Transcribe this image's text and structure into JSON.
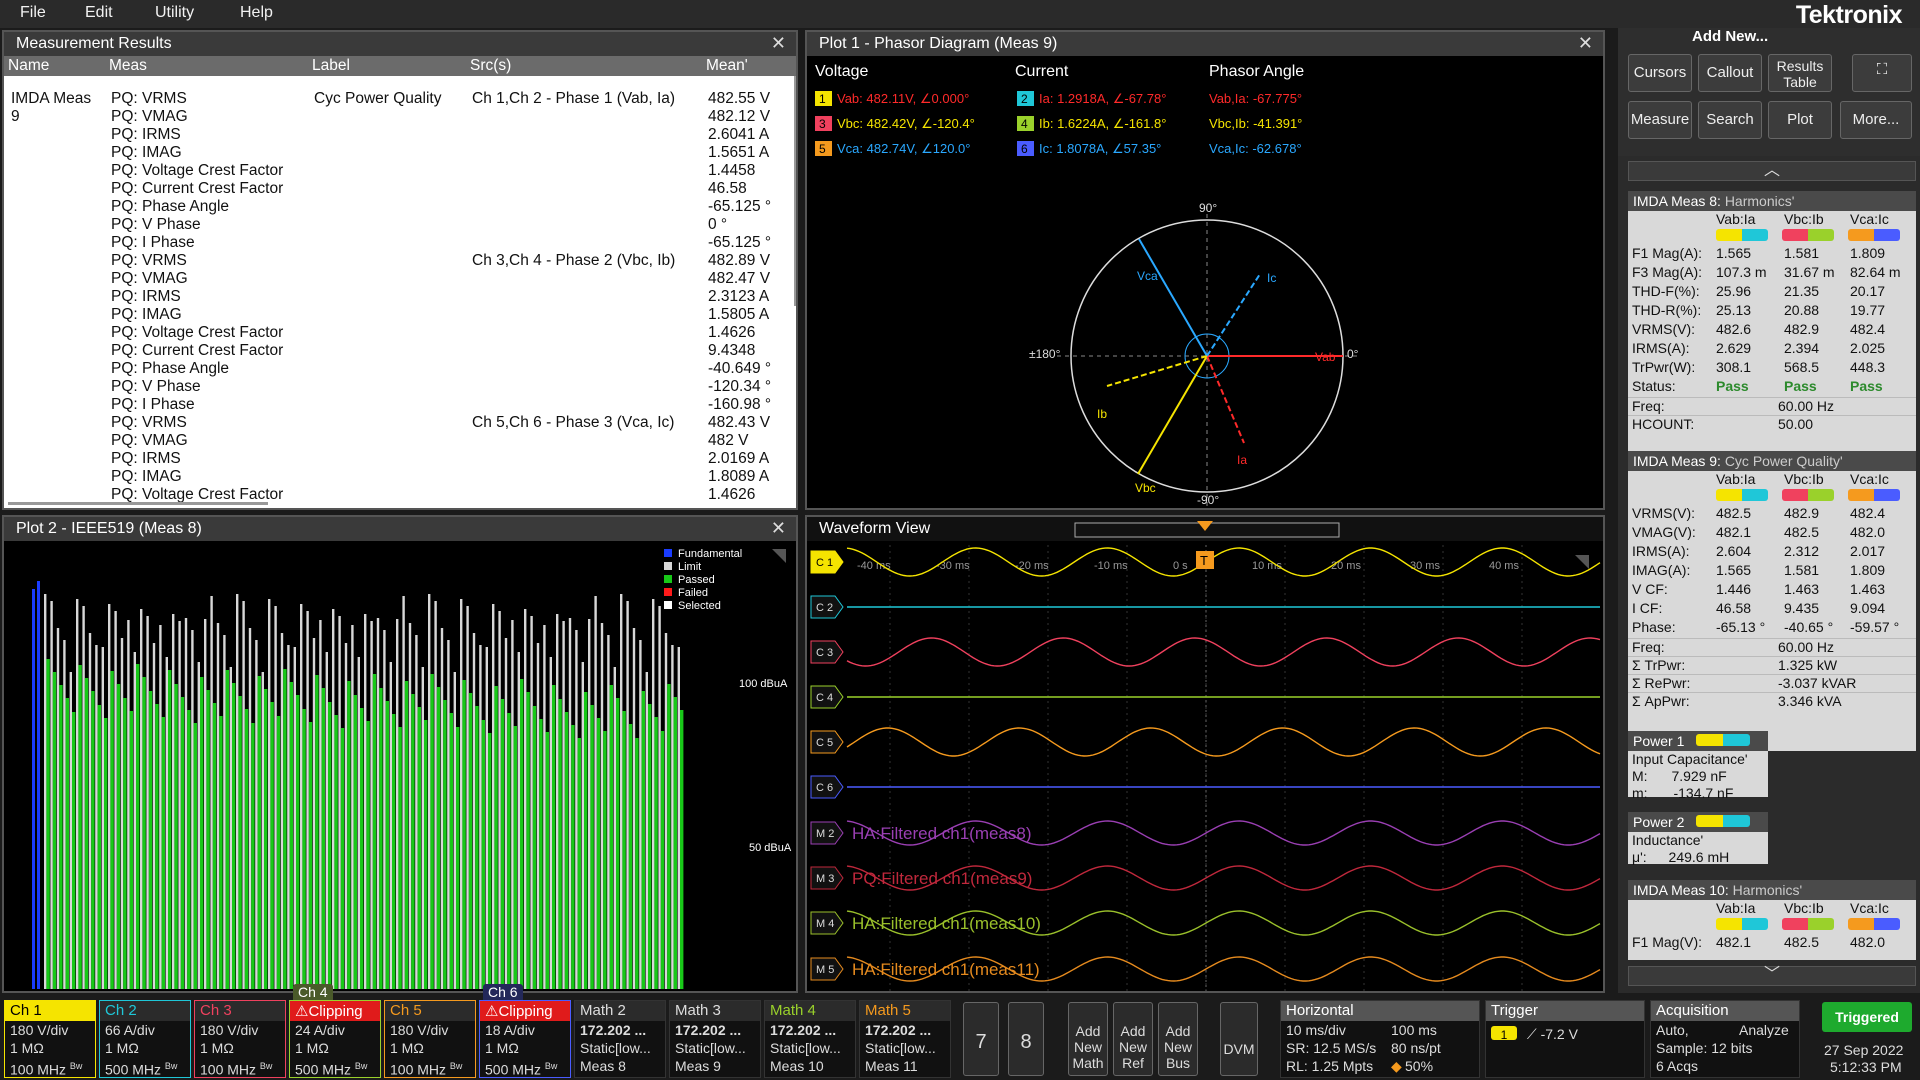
{
  "menu": [
    "File",
    "Edit",
    "Utility",
    "Help"
  ],
  "brand": "Tektronix",
  "meas": {
    "title": "Measurement Results",
    "headers": [
      "Name",
      "Meas",
      "Label",
      "Src(s)",
      "Mean'"
    ],
    "name": "IMDA Meas\n9",
    "meas": "PQ: VRMS\nPQ: VMAG\nPQ: IRMS\nPQ: IMAG\nPQ: Voltage Crest Factor\nPQ: Current Crest Factor\nPQ: Phase Angle\nPQ: V Phase\nPQ: I Phase\nPQ: VRMS\nPQ: VMAG\nPQ: IRMS\nPQ: IMAG\nPQ: Voltage Crest Factor\nPQ: Current Crest Factor\nPQ: Phase Angle\nPQ: V Phase\nPQ: I Phase\nPQ: VRMS\nPQ: VMAG\nPQ: IRMS\nPQ: IMAG\nPQ: Voltage Crest Factor",
    "label": "Cyc Power Quality",
    "src1": "Ch 1,Ch 2 - Phase 1 (Vab, Ia)",
    "src2": "Ch 3,Ch 4 - Phase 2 (Vbc, Ib)",
    "src3": "Ch 5,Ch 6 - Phase 3 (Vca, Ic)",
    "mean": "482.55 V\n482.12 V\n2.6041 A\n1.5651 A\n1.4458\n46.58\n-65.125 °\n0 °\n-65.125 °\n482.89 V\n482.47 V\n2.3123 A\n1.5805 A\n1.4626\n9.4348\n-40.649 °\n-120.34 °\n-160.98 °\n482.43 V\n482 V\n2.0169 A\n1.8089 A\n1.4626"
  },
  "phasor": {
    "title": "Plot 1 - Phasor Diagram (Meas 9)",
    "h_volt": "Voltage",
    "h_cur": "Current",
    "h_ang": "Phasor Angle",
    "v1": "Vab: 482.11V, ∠0.000°",
    "v2": "Vbc: 482.42V, ∠-120.4°",
    "v3": "Vca: 482.74V, ∠120.0°",
    "i1": "Ia: 1.2918A, ∠-67.78°",
    "i2": "Ib: 1.6224A, ∠-161.8°",
    "i3": "Ic: 1.8078A, ∠57.35°",
    "a1": "Vab,Ia: -67.775°",
    "a2": "Vbc,Ib: -41.391°",
    "a3": "Vca,Ic: -62.678°",
    "n1": "1",
    "n2": "3",
    "n3": "5",
    "n4": "2",
    "n5": "4",
    "n6": "6",
    "deg90": "90°",
    "degm90": "-90°",
    "deg0": "0°",
    "deg180": "±180°",
    "vab": "Vab",
    "vbc": "Vbc",
    "vca": "Vca",
    "ia": "Ia",
    "ib": "Ib",
    "ic": "Ic"
  },
  "ieee": {
    "title": "Plot 2 - IEEE519 (Meas 8)",
    "legend": [
      "Fundamental",
      "Limit",
      "Passed",
      "Failed",
      "Selected"
    ],
    "lbl100": "100 dBuA",
    "lbl50": "50 dBuA",
    "colors": {
      "fundamental": "#1a3cff",
      "limit": "#d8d8d8",
      "passed": "#18c818",
      "failed": "#ff1a1a",
      "selected": "#ffffff"
    }
  },
  "wave": {
    "title": "Waveform View",
    "times": [
      "-40 ms",
      "-30 ms",
      "-20 ms",
      "-10 ms",
      "0 s",
      "10 ms",
      "20 ms",
      "30 ms",
      "40 ms"
    ],
    "ch": [
      "C 1",
      "C 2",
      "C 3",
      "C 4",
      "C 5",
      "C 6",
      "M 2",
      "M 3",
      "M 4",
      "M 5"
    ],
    "math": [
      "HA:Filtered ch1(meas8)",
      "PQ:Filtered ch1(meas9)",
      "HA:Filtered ch1(meas10)",
      "HA:Filtered ch1(meas11)"
    ],
    "trig": "T"
  },
  "right": {
    "addnew": "Add New...",
    "btns": [
      "Cursors",
      "Callout",
      "Results Table",
      "Measure",
      "Search",
      "Plot",
      "More..."
    ],
    "m8": {
      "title": "IMDA Meas 8:",
      "sub": "Harmonics'",
      "cols": [
        "Vab:Ia",
        "Vbc:Ib",
        "Vca:Ic"
      ],
      "rows": [
        [
          "F1 Mag(A):",
          "1.565",
          "1.581",
          "1.809"
        ],
        [
          "F3 Mag(A):",
          "107.3 m",
          "31.67 m",
          "82.64 m"
        ],
        [
          "THD-F(%):",
          "25.96",
          "21.35",
          "20.17"
        ],
        [
          "THD-R(%):",
          "25.13",
          "20.88",
          "19.77"
        ],
        [
          "VRMS(V):",
          "482.6",
          "482.9",
          "482.4"
        ],
        [
          "IRMS(A):",
          "2.629",
          "2.394",
          "2.025"
        ],
        [
          "TrPwr(W):",
          "308.1",
          "568.5",
          "448.3"
        ],
        [
          "Status:",
          "Pass",
          "Pass",
          "Pass"
        ]
      ],
      "freq": "Freq:",
      "freqv": "60.00 Hz",
      "hc": "HCOUNT:",
      "hcv": "50.00"
    },
    "m9": {
      "title": "IMDA Meas 9:",
      "sub": "Cyc Power Quality'",
      "cols": [
        "Vab:Ia",
        "Vbc:Ib",
        "Vca:Ic"
      ],
      "rows": [
        [
          "VRMS(V):",
          "482.5",
          "482.9",
          "482.4"
        ],
        [
          "VMAG(V):",
          "482.1",
          "482.5",
          "482.0"
        ],
        [
          "IRMS(A):",
          "2.604",
          "2.312",
          "2.017"
        ],
        [
          "IMAG(A):",
          "1.565",
          "1.581",
          "1.809"
        ],
        [
          "V CF:",
          "1.446",
          "1.463",
          "1.463"
        ],
        [
          "I CF:",
          "46.58",
          "9.435",
          "9.094"
        ],
        [
          "Phase:",
          "-65.13 °",
          "-40.65 °",
          "-59.57 °"
        ]
      ],
      "sums": [
        [
          "Freq:",
          "60.00 Hz"
        ],
        [
          "Σ TrPwr:",
          "1.325 kW"
        ],
        [
          "Σ RePwr:",
          "-3.037 kVAR"
        ],
        [
          "Σ ApPwr:",
          "3.346 kVA"
        ]
      ]
    },
    "p1": {
      "title": "Power 1",
      "sub": "Input Capacitance'",
      "r1": "M:",
      "v1": "7.929 nF",
      "r2": "m:",
      "v2": "-134.7 nF"
    },
    "p2": {
      "title": "Power 2",
      "sub": "Inductance'",
      "r1": "μ':",
      "v1": "249.6 mH"
    },
    "m10": {
      "title": "IMDA Meas 10:",
      "sub": "Harmonics'",
      "cols": [
        "Vab:Ia",
        "Vbc:Ib",
        "Vca:Ic"
      ],
      "row": [
        "F1 Mag(V):",
        "482.1",
        "482.5",
        "482.0"
      ]
    }
  },
  "bottom": {
    "chs": [
      {
        "t": "Ch 1",
        "l1": "180 V/div",
        "l2": "1 MΩ",
        "l3": "100 MHz",
        "bw": "Bw",
        "color": "#f5e400"
      },
      {
        "t": "Ch 2",
        "l1": "66 A/div",
        "l2": "1 MΩ",
        "l3": "500 MHz",
        "bw": "Bw",
        "color": "#1fc7d8"
      },
      {
        "t": "Ch 3",
        "l1": "180 V/div",
        "l2": "1 MΩ",
        "l3": "100 MHz",
        "bw": "Bw",
        "color": "#f0415e"
      },
      {
        "t": "Clipping",
        "tab": "Ch 4",
        "l1": "24 A/div",
        "l2": "1 MΩ",
        "l3": "500 MHz",
        "bw": "Bw",
        "color": "#9ad12b"
      },
      {
        "t": "Ch 5",
        "l1": "180 V/div",
        "l2": "1 MΩ",
        "l3": "100 MHz",
        "bw": "Bw",
        "color": "#f59a1e"
      },
      {
        "t": "Clipping",
        "tab": "Ch 6",
        "l1": "18 A/div",
        "l2": "1 MΩ",
        "l3": "500 MHz",
        "bw": "Bw",
        "color": "#4a5cff"
      }
    ],
    "maths": [
      {
        "t": "Math 2",
        "l1": "172.202 ...",
        "l2": "Static[low...",
        "l3": "Meas 8",
        "color": "#ddd"
      },
      {
        "t": "Math 3",
        "l1": "172.202 ...",
        "l2": "Static[low...",
        "l3": "Meas 9",
        "color": "#ddd"
      },
      {
        "t": "Math 4",
        "l1": "172.202 ...",
        "l2": "Static[low...",
        "l3": "Meas 10",
        "color": "#9ad12b"
      },
      {
        "t": "Math 5",
        "l1": "172.202 ...",
        "l2": "Static[low...",
        "l3": "Meas 11",
        "color": "#f59a1e"
      }
    ],
    "n7": "7",
    "n8": "8",
    "addmath": "Add\nNew\nMath",
    "addref": "Add\nNew\nRef",
    "addbus": "Add\nNew\nBus",
    "dvm": "DVM",
    "hor": {
      "t": "Horizontal",
      "a": "10 ms/div",
      "b": "100 ms",
      "c": "SR: 12.5 MS/s",
      "d": "80 ns/pt",
      "e": "RL: 1.25 Mpts",
      "f": "50%"
    },
    "trig": {
      "t": "Trigger",
      "ch": "1",
      "v": "-7.2 V"
    },
    "acq": {
      "t": "Acquisition",
      "a": "Auto,",
      "b": "Analyze",
      "c": "Sample: 12 bits",
      "d": "6 Acqs"
    },
    "triggered": "Triggered",
    "date": "27 Sep 2022",
    "time": "5:12:33 PM"
  }
}
